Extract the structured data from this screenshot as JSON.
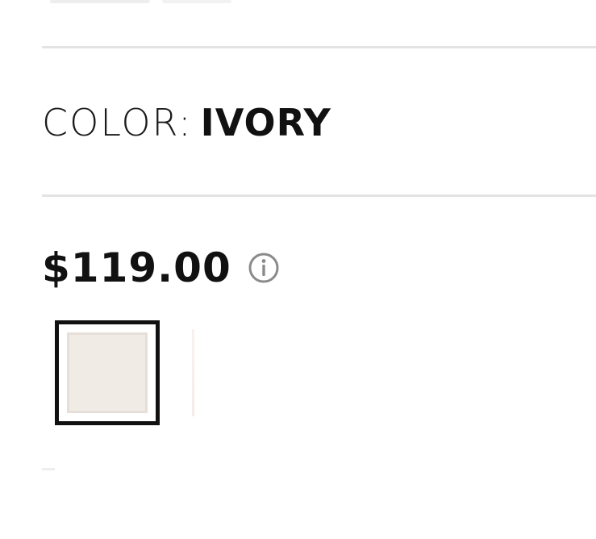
{
  "product": {
    "color_label": "COLOR:",
    "color_value": "IVORY",
    "price": "$119.00",
    "info_icon": "info-circle-icon"
  },
  "swatches": [
    {
      "name": "Ivory",
      "color": "#f1ebe6",
      "selected": true
    }
  ],
  "colors": {
    "text": "#111111",
    "divider": "#e3e3e3",
    "swatch_border_selected": "#111111",
    "info_icon": "#8a8a8a"
  }
}
